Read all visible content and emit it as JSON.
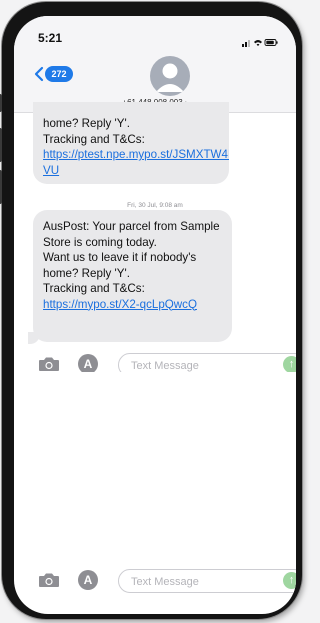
{
  "status_bar": {
    "time": "5:21"
  },
  "header": {
    "unread_count": "272",
    "contact_number": "+61 448 008 003",
    "contact_chevron": "›"
  },
  "messages": [
    {
      "lines": [
        "home? Reply 'Y'."
      ],
      "link_prefix": "Tracking and T&Cs: ",
      "link": "https://ptest.npe.mypo.st/JSMXTW4I-VU"
    },
    {
      "timestamp": "Fri, 30 Jul, 9:08 am",
      "lines": [
        "AusPost: Your parcel from Sample Store is coming today.",
        "Want us to leave it if nobody's home? Reply 'Y'."
      ],
      "link_prefix": "Tracking and T&Cs: ",
      "link": "https://mypo.st/X2-qcLpQwcQ"
    }
  ],
  "composer": {
    "placeholder": "Text Message",
    "value": ""
  },
  "icons": {
    "back": "chevron-left-icon",
    "avatar": "person-icon",
    "camera": "camera-icon",
    "apps": "app-store-icon",
    "send": "arrow-up-icon"
  },
  "colors": {
    "accent": "#1f7ae8",
    "bubble": "#e9e9eb",
    "link": "#1a6fde",
    "send": "#9fd6a0"
  }
}
